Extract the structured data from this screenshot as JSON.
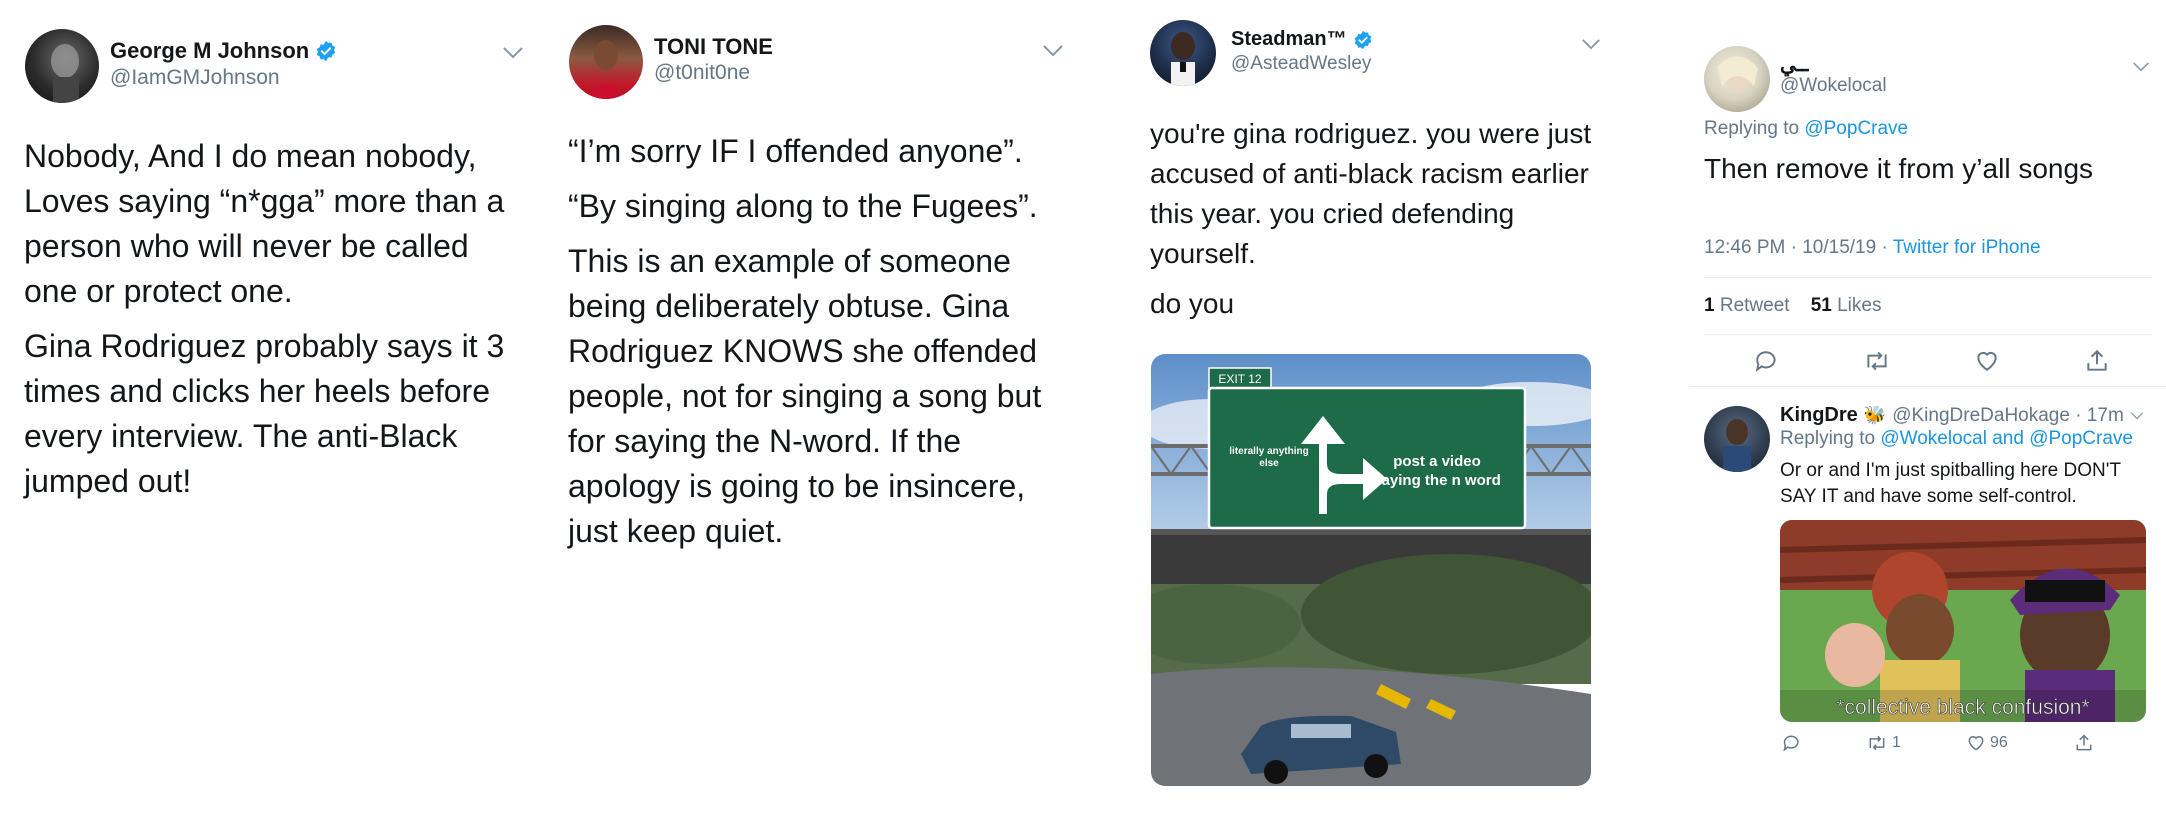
{
  "tweet1": {
    "name": "George M Johnson",
    "handle": "@IamGMJohnson",
    "paragraphs": [
      "Nobody, And I do mean nobody, Loves saying “n*gga” more than a person who will never be called one or protect one.",
      "Gina Rodriguez probably says  it 3 times and clicks her heels before every interview. The anti-Black jumped out!"
    ]
  },
  "tweet2": {
    "name": "TONI TONE",
    "handle": "@t0nit0ne",
    "paragraphs": [
      "“I’m sorry IF I offended anyone”.",
      "“By singing along to the Fugees”.",
      "This is an example of someone being deliberately obtuse. Gina Rodriguez KNOWS she offended people, not for singing a song but for saying the N-word. If the apology is going to be insincere, just keep quiet."
    ]
  },
  "tweet3": {
    "name": "Steadman™",
    "handle": "@AsteadWesley",
    "paragraphs": [
      "you're gina rodriguez. you were just accused of anti-black racism earlier this year. you cried defending yourself.",
      "do you"
    ],
    "meme": {
      "exit_label": "EXIT 12",
      "left_label_line1": "literally anything",
      "left_label_line2": "else",
      "right_label_line1": "post a video",
      "right_label_line2": "saying the n word"
    }
  },
  "tweet4": {
    "name": "ــي",
    "handle": "@Wokelocal",
    "replying_prefix": "Replying to",
    "replying_to": "@PopCrave",
    "text": "Then remove it from y’all songs",
    "time": "12:46 PM · 10/15/19 ·",
    "client": "Twitter for iPhone",
    "retweets_count": "1",
    "retweets_label": "Retweet",
    "likes_count": "51",
    "likes_label": "Likes",
    "reply": {
      "name": "KingDre",
      "handle": "@KingDreDaHokage · 17m",
      "replying_prefix": "Replying to",
      "replying_to": "@Wokelocal and @PopCrave",
      "text": "Or or and I'm just spitballing here DON'T SAY IT and have some self-control.",
      "image_caption": "*collective black confusion*",
      "retweets": "1",
      "likes": "96"
    }
  },
  "colors": {
    "link_blue": "#1b95e0",
    "verified_blue": "#1da1f2",
    "secondary_grey": "#657786",
    "sign_green": "#1e6b4a"
  }
}
